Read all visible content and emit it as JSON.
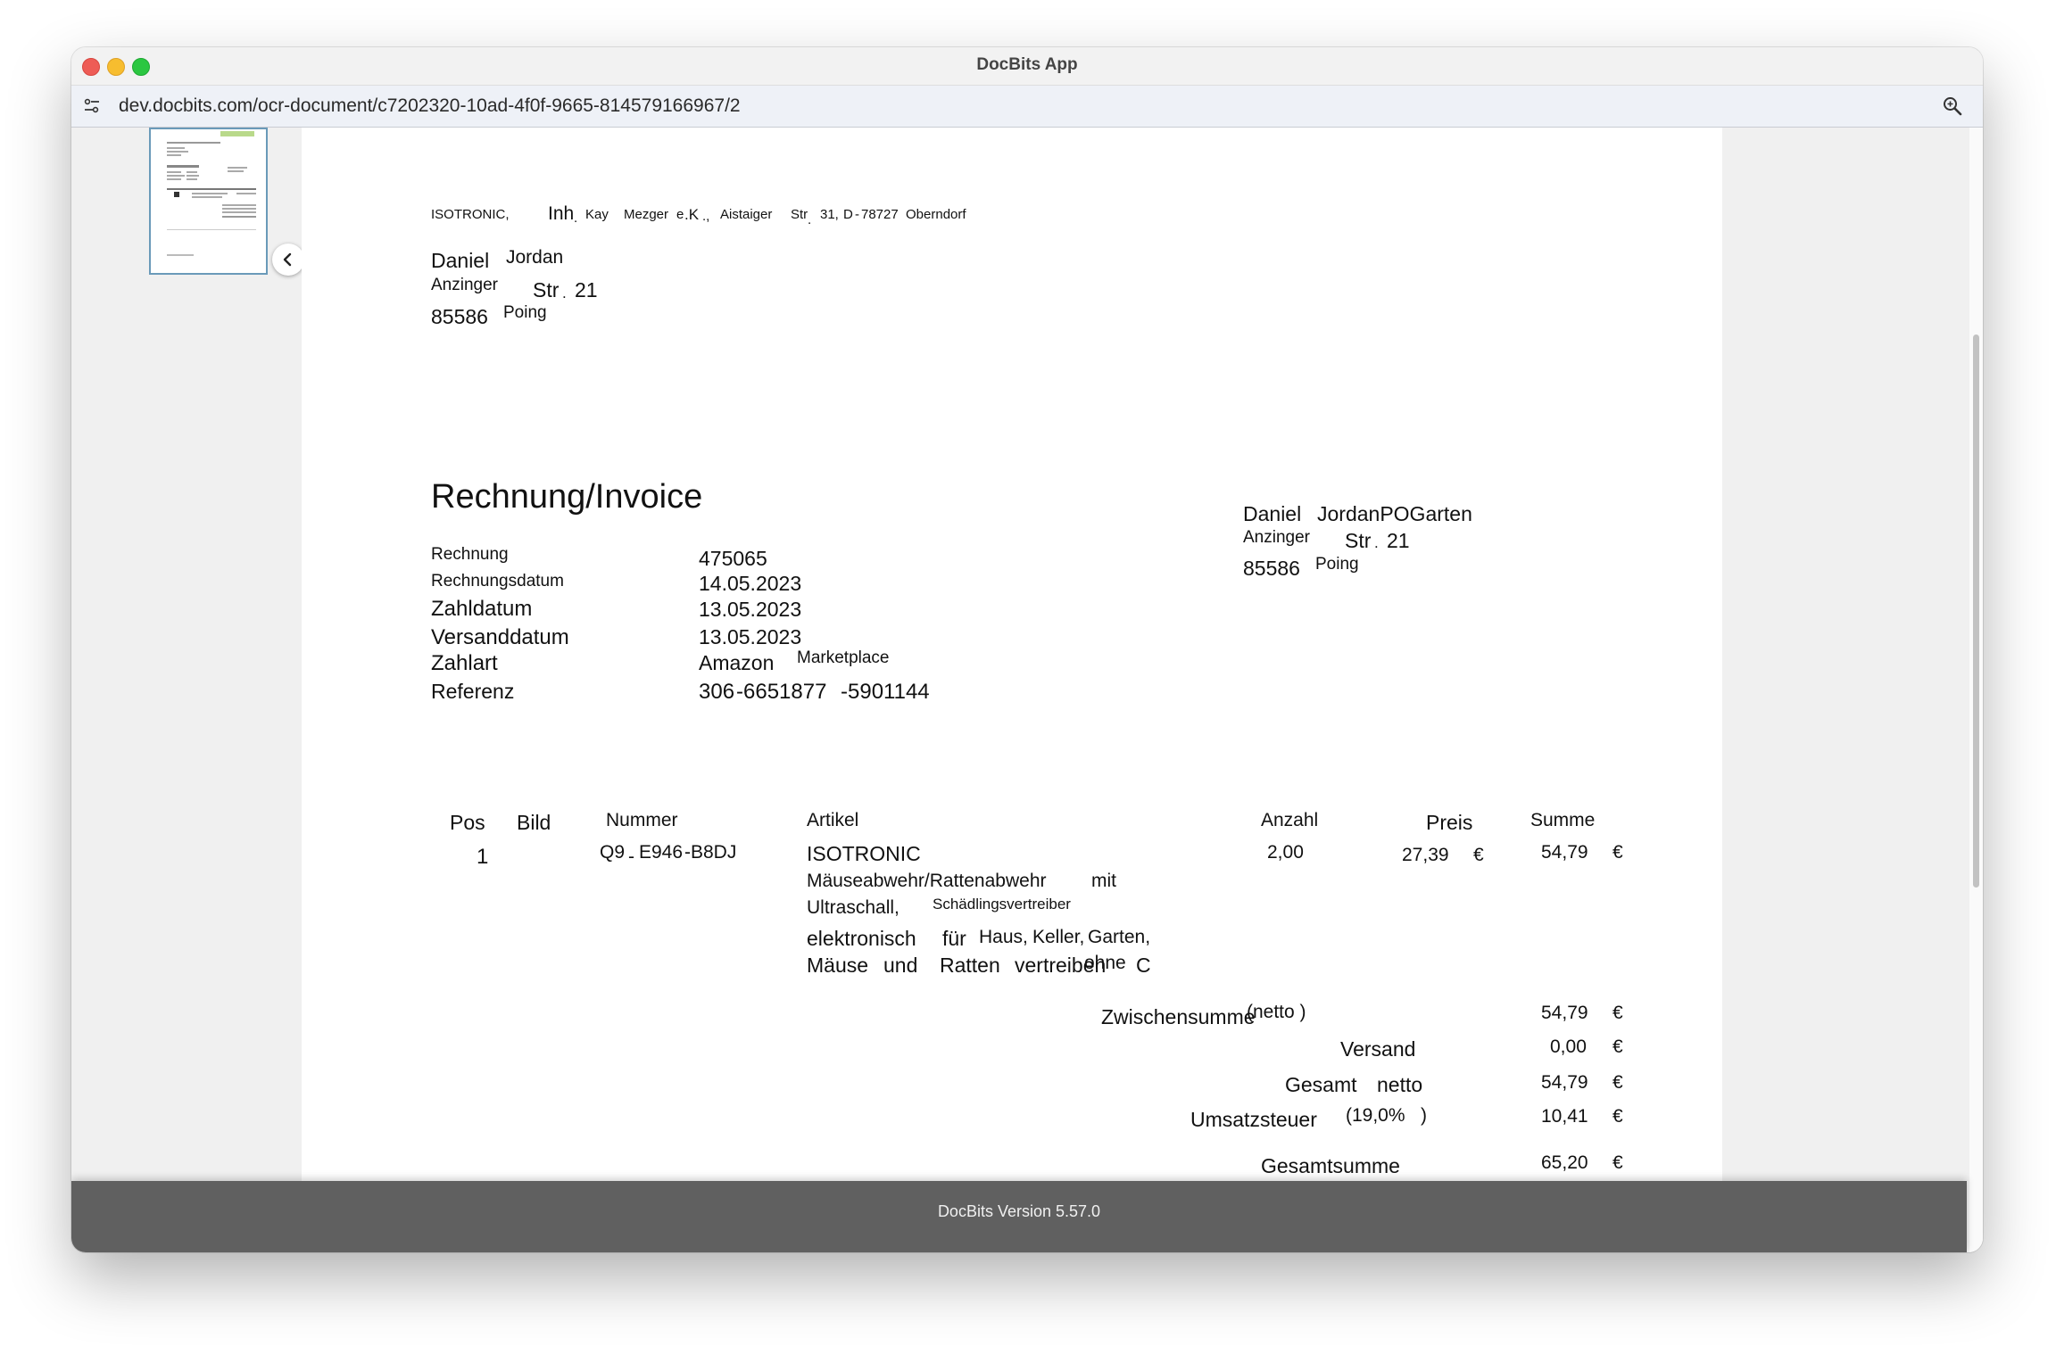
{
  "window": {
    "title": "DocBits App"
  },
  "browser": {
    "url": "dev.docbits.com/ocr-document/c7202320-10ad-4f0f-9665-814579166967/2"
  },
  "sender_line": {
    "w1": "ISOTRONIC,",
    "w2": "Inh",
    "w2b": ".",
    "w3": "Kay",
    "w4": "Mezger",
    "w5": "e",
    "w5b": ".K",
    "w5c": ".,",
    "w6": "Aistaiger",
    "w7": "Str",
    "w7b": ".",
    "w8": "31,",
    "w9": "D",
    "w9b": "-",
    "w10": "78727",
    "w11": "Oberndorf"
  },
  "recipient": {
    "first_name": "Daniel",
    "last_name": "Jordan",
    "street_a": "Anzinger",
    "street_b": "Str",
    "street_dot": ".",
    "street_no": "21",
    "zip": "85586",
    "city": "Poing"
  },
  "invoice": {
    "title": "Rechnung/Invoice",
    "labels": {
      "rechnung": "Rechnung",
      "rechnungsdatum": "Rechnungsdatum",
      "zahldatum": "Zahldatum",
      "versanddatum": "Versanddatum",
      "zahlart": "Zahlart",
      "referenz": "Referenz"
    },
    "values": {
      "rechnung": "475065",
      "rechnungsdatum": "14.05.2023",
      "zahldatum": "13.05.2023",
      "versanddatum": "13.05.2023",
      "zahlart_a": "Amazon",
      "zahlart_b": "Marketplace",
      "referenz_a": "306",
      "referenz_b": "-6651877",
      "referenz_c": "-5901144"
    }
  },
  "shipping_address": {
    "first_name": "Daniel",
    "last_name": "JordanPOGarten",
    "street_a": "Anzinger",
    "street_b": "Str",
    "street_dot": ".",
    "street_no": "21",
    "zip": "85586",
    "city": "Poing"
  },
  "table": {
    "headers": {
      "pos": "Pos",
      "bild": "Bild",
      "nummer": "Nummer",
      "artikel": "Artikel",
      "anzahl": "Anzahl",
      "preis": "Preis",
      "summe": "Summe"
    },
    "row": {
      "pos": "1",
      "nummer_a": "Q9",
      "nummer_b": "-",
      "nummer_c": "E946",
      "nummer_d": "-B8DJ",
      "artikel": {
        "l1": "ISOTRONIC",
        "l2a": "Mäuseabwehr/Rattenabwehr",
        "l2b": "mit",
        "l3a": "Ultraschall,",
        "l3b": "Schädlingsvertreiber",
        "l4a": "elektronisch",
        "l4b": "für",
        "l4c": "Haus,",
        "l4d": "Keller,",
        "l4e": "Garten,",
        "l5a": "Mäuse",
        "l5b": "und",
        "l5c": "Ratten",
        "l5d": "vertreiben",
        "l5e": "ohne",
        "l5f": "C"
      },
      "anzahl": "2,00",
      "preis": "27,39",
      "preis_cur": "€",
      "summe": "54,79",
      "summe_cur": "€"
    }
  },
  "totals": {
    "zwischensumme": "Zwischensumme",
    "netto_paren": "(netto )",
    "zwischensumme_val": "54,79",
    "versand": "Versand",
    "versand_val": "0,00",
    "gesamt_a": "Gesamt",
    "gesamt_b": "netto",
    "gesamt_val": "54,79",
    "ust": "Umsatzsteuer",
    "ust_rate": "(19,0%",
    "ust_paren": ")",
    "ust_val": "10,41",
    "gesamtsumme": "Gesamtsumme",
    "gesamtsumme_val": "65,20",
    "currency": "€"
  },
  "footer": {
    "version": "DocBits Version 5.57.0"
  },
  "colors": {
    "footer_bg": "#606060",
    "thumb_border": "#6a9ab9",
    "urlbar_bg": "#eef1f7"
  }
}
